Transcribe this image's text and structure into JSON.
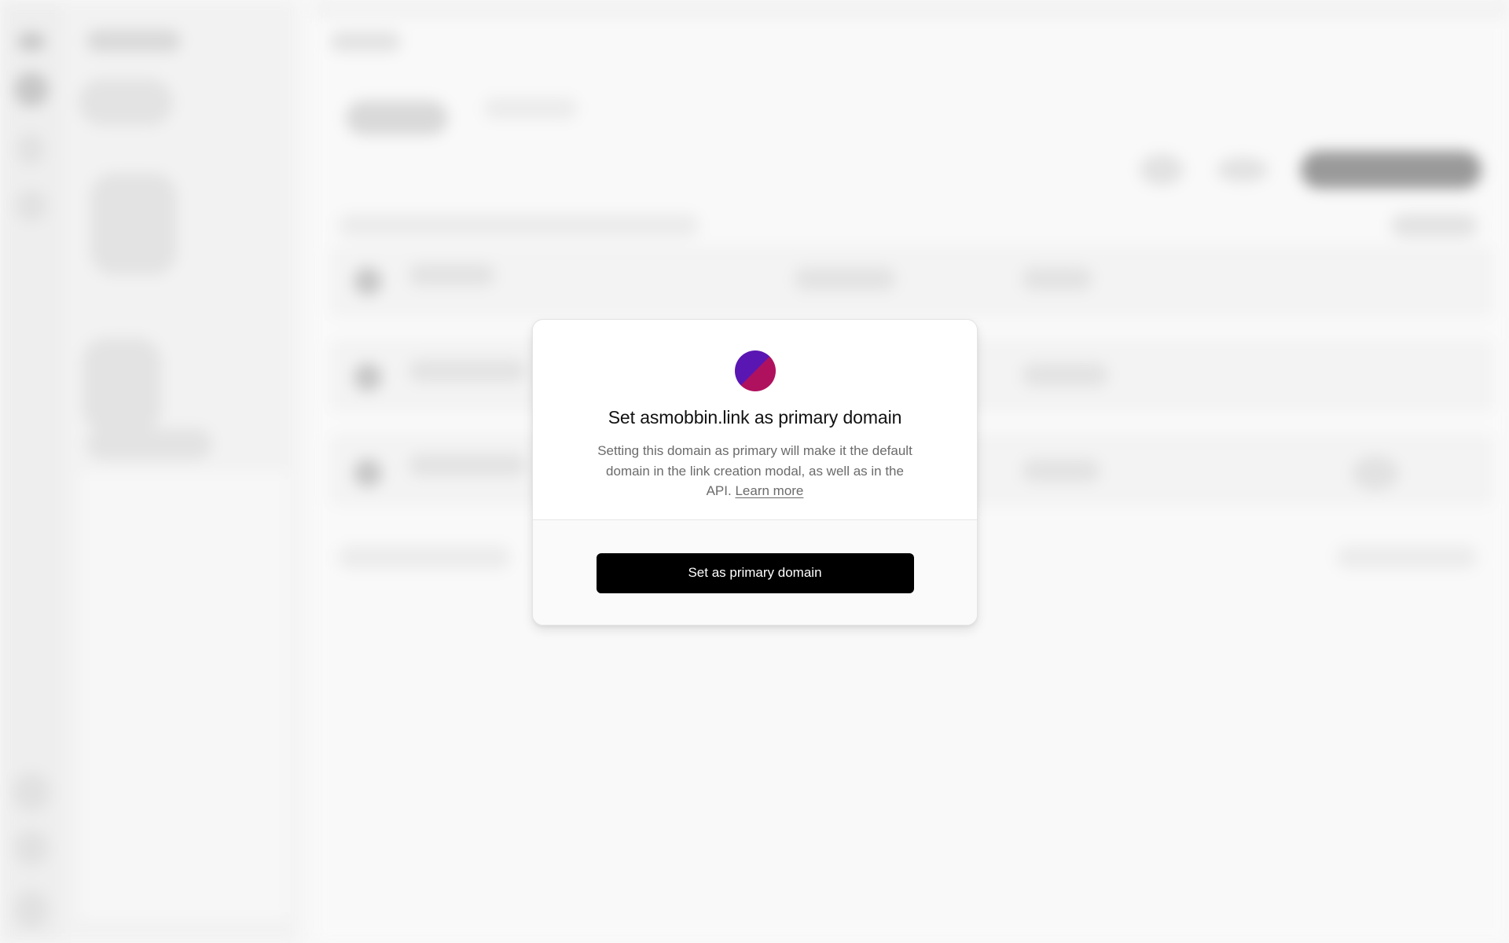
{
  "modal": {
    "logo_icon": "domain-logo-icon",
    "logo_colors": [
      "#5a16b2",
      "#b0115e"
    ],
    "title": "Set asmobbin.link as primary domain",
    "description": "Setting this domain as primary will make it the default domain in the link creation modal, as well as in the API.",
    "learn_more_label": "Learn more",
    "primary_button_label": "Set as primary domain"
  }
}
